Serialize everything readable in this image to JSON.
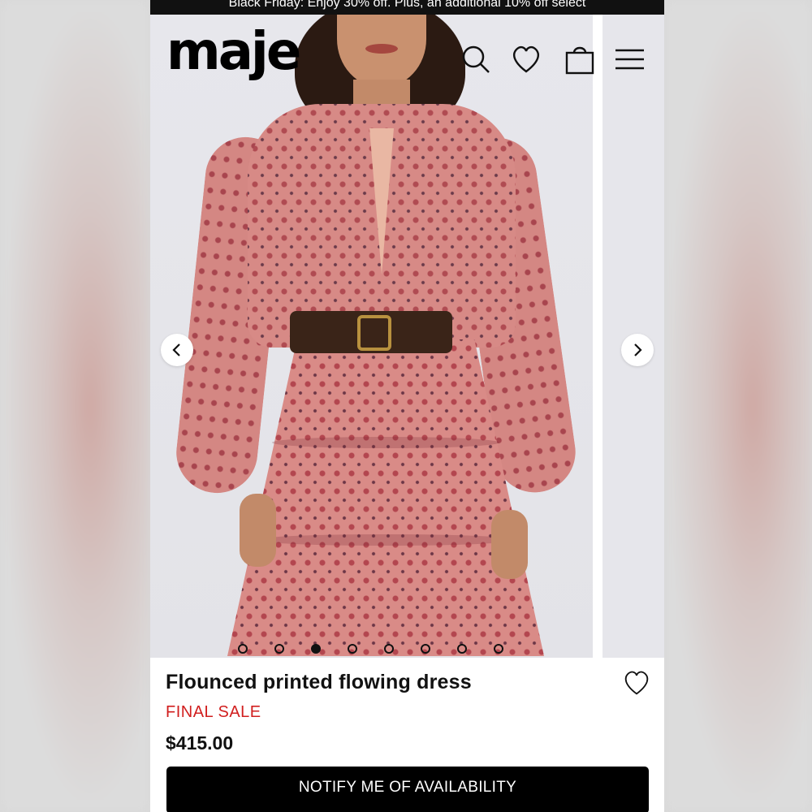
{
  "promo": {
    "text": "Black Friday: Enjoy 30% off. Plus, an additional 10% off select"
  },
  "header": {
    "logo": "maje",
    "icons": [
      "search-icon",
      "heart-icon",
      "bag-icon",
      "menu-icon"
    ]
  },
  "gallery": {
    "total_images": 8,
    "active_index": 3,
    "arrows": [
      "chevron-left-icon",
      "chevron-right-icon"
    ]
  },
  "product": {
    "title": "Flounced printed flowing dress",
    "badge": "FINAL SALE",
    "price": "$415.00",
    "wishlist_icon": "heart-icon"
  },
  "cta": {
    "label": "NOTIFY ME OF AVAILABILITY"
  },
  "colors": {
    "badge": "#d11f1f",
    "button_bg": "#000000",
    "banner_bg": "#111111"
  }
}
